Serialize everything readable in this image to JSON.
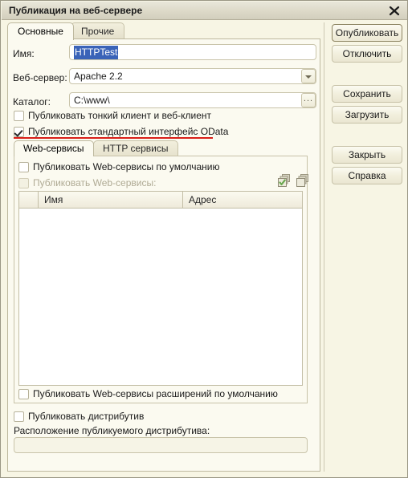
{
  "window": {
    "title": "Публикация на веб-сервере",
    "close_icon": "close-icon"
  },
  "tabs": [
    {
      "label": "Основные",
      "active": true
    },
    {
      "label": "Прочие",
      "active": false
    }
  ],
  "form": {
    "name": {
      "label": "Имя:",
      "value": "HTTPTest",
      "selected": true
    },
    "webserver": {
      "label": "Веб-сервер:",
      "value": "Apache 2.2",
      "dropdown_icon": "chevron-down-icon"
    },
    "catalog": {
      "label": "Каталог:",
      "value": "C:\\www\\",
      "browse_icon": "ellipsis-icon",
      "browse_label": "..."
    },
    "publish_thin_client": {
      "label": "Публиковать тонкий клиент и веб-клиент",
      "checked": false
    },
    "publish_odata": {
      "label": "Публиковать стандартный интерфейс OData",
      "checked": true,
      "highlight_color": "#d91e18"
    }
  },
  "inner_tabs": [
    {
      "label": "Web-сервисы",
      "active": true
    },
    {
      "label": "HTTP сервисы",
      "active": false
    }
  ],
  "web_services": {
    "publish_default": {
      "label": "Публиковать Web-сервисы по умолчанию",
      "checked": false,
      "disabled": false
    },
    "publish_list": {
      "label": "Публиковать Web-сервисы:",
      "checked": false,
      "disabled": true
    },
    "toolbar": [
      {
        "icon": "check-all-layers-icon"
      },
      {
        "icon": "layers-icon"
      }
    ],
    "table": {
      "columns": [
        "",
        "Имя",
        "Адрес"
      ],
      "rows": []
    },
    "publish_extensions_default": {
      "label": "Публиковать Web-сервисы расширений по умолчанию",
      "checked": false
    }
  },
  "distributive": {
    "publish": {
      "label": "Публиковать дистрибутив",
      "checked": false
    },
    "location_label": "Расположение публикуемого дистрибутива:",
    "location_value": "",
    "location_placeholder": ""
  },
  "buttons": [
    {
      "label": "Опубликовать",
      "default": true
    },
    {
      "label": "Отключить",
      "default": false
    },
    {
      "label": "Сохранить",
      "default": false
    },
    {
      "label": "Загрузить",
      "default": false
    },
    {
      "label": "Закрыть",
      "default": false
    },
    {
      "label": "Справка",
      "default": false
    }
  ]
}
